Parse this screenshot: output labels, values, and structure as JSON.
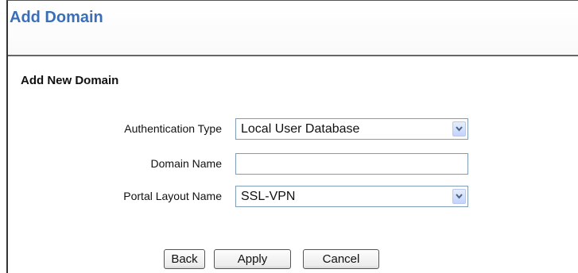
{
  "header": {
    "title": "Add Domain"
  },
  "section": {
    "title": "Add New Domain"
  },
  "form": {
    "auth_type": {
      "label": "Authentication Type",
      "value": "Local User Database"
    },
    "domain_name": {
      "label": "Domain Name",
      "value": ""
    },
    "portal_layout": {
      "label": "Portal Layout Name",
      "value": "SSL-VPN"
    }
  },
  "buttons": {
    "back": "Back",
    "apply": "Apply",
    "cancel": "Cancel"
  }
}
